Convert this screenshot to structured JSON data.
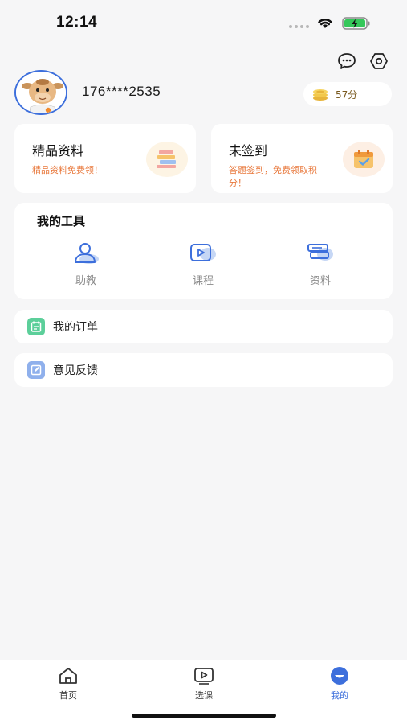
{
  "status_bar": {
    "time": "12:14"
  },
  "profile": {
    "phone": "176****2535",
    "points": "57分"
  },
  "feature_cards": [
    {
      "title": "精品资料",
      "desc": "精品资料免费领！"
    },
    {
      "title": "未签到",
      "desc": "答题签到，免费领取积分！"
    }
  ],
  "tools": {
    "title": "我的工具",
    "items": [
      {
        "label": "助教"
      },
      {
        "label": "课程"
      },
      {
        "label": "资料"
      }
    ]
  },
  "list_rows": [
    {
      "label": "我的订单"
    },
    {
      "label": "意见反馈"
    }
  ],
  "tabbar": {
    "items": [
      {
        "label": "首页"
      },
      {
        "label": "选课"
      },
      {
        "label": "我的"
      }
    ],
    "active": "我的"
  },
  "colors": {
    "accent": "#3d6fdc",
    "orange": "#e8773a",
    "green": "#5ccf9a"
  }
}
